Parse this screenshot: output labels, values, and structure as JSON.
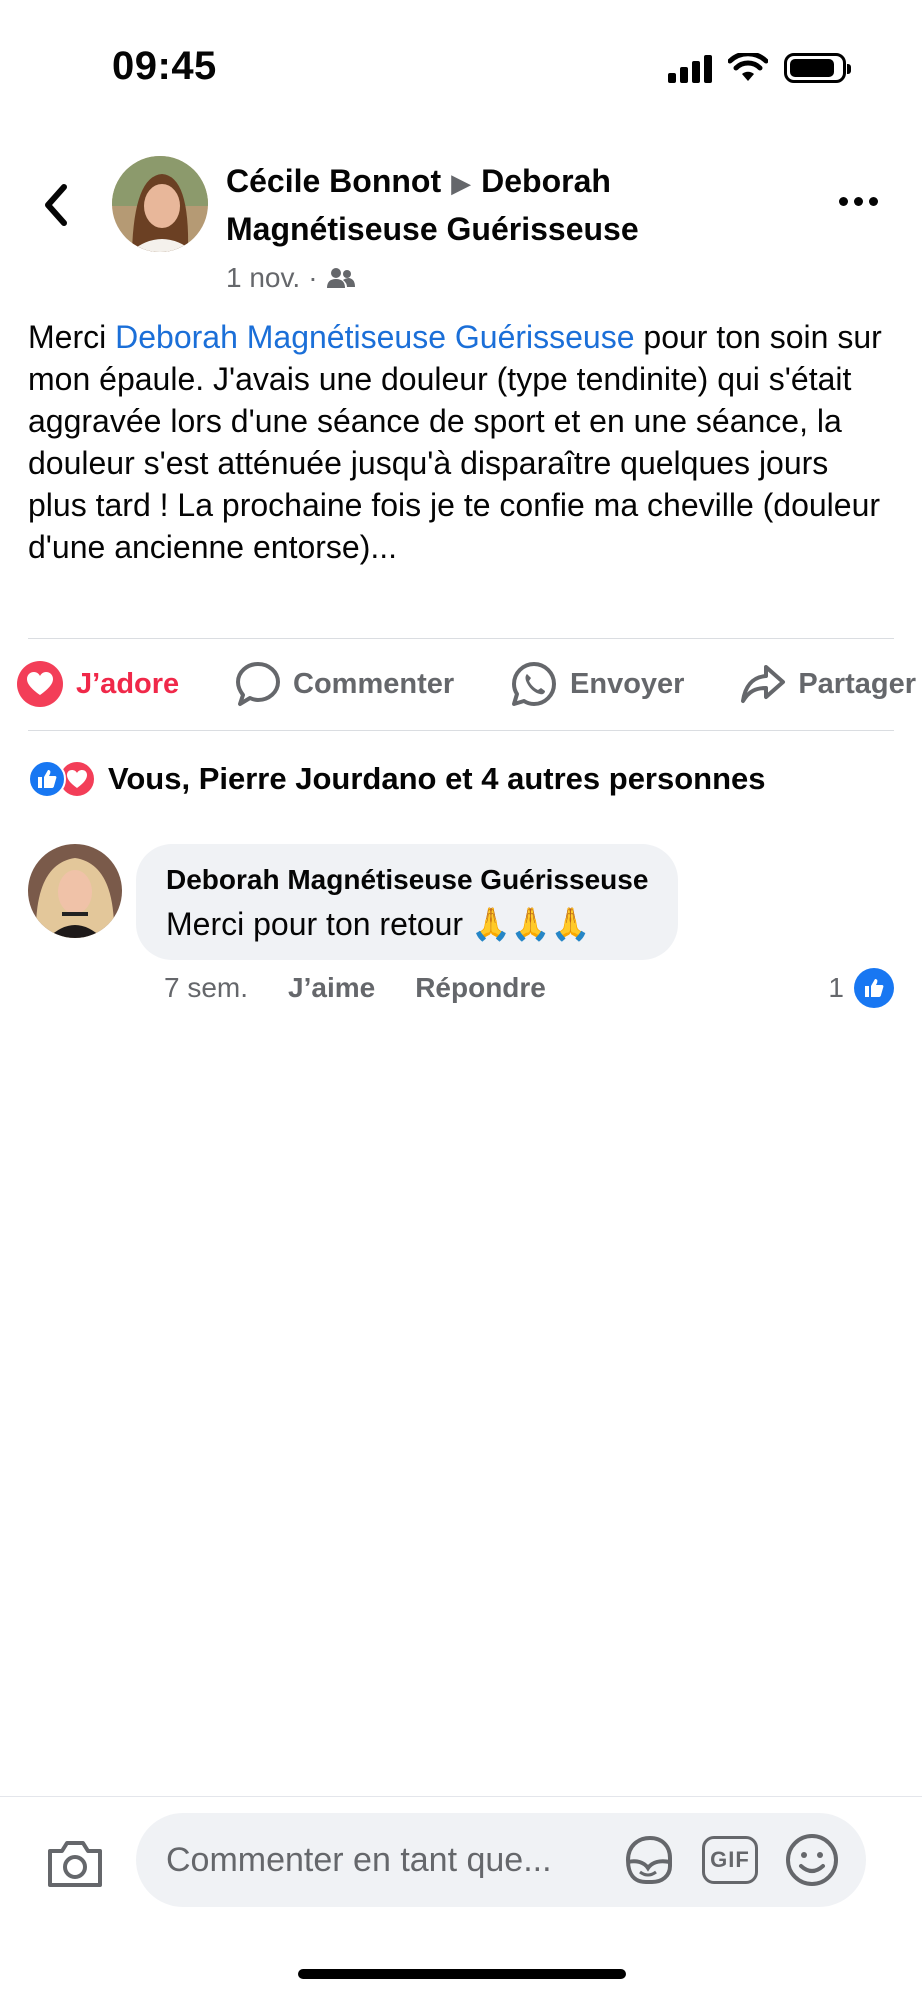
{
  "status_bar": {
    "time": "09:45"
  },
  "header": {
    "author": "Cécile Bonnot",
    "separator": "▶",
    "target": "Deborah Magnétiseuse Guérisseuse",
    "date": "1 nov.",
    "dot": "·"
  },
  "post": {
    "text_before": "Merci ",
    "mention": "Deborah Magnétiseuse Guérisseuse",
    "text_after": " pour ton soin sur mon épaule. J'avais une douleur (type tendinite) qui s'était aggravée lors d'une séance de sport et en une séance, la douleur s'est atténuée jusqu'à disparaître quelques jours plus tard ! La prochaine fois je te confie ma cheville (douleur d'une ancienne entorse)..."
  },
  "actions": {
    "love_label": "J’adore",
    "comment_label": "Commenter",
    "send_label": "Envoyer",
    "share_label": "Partager"
  },
  "reactions": {
    "summary": "Vous, Pierre Jourdano et 4 autres personnes"
  },
  "comment": {
    "author": "Deborah Magnétiseuse Guérisseuse",
    "text": "Merci pour ton retour",
    "emoji": "🙏🙏🙏",
    "time": "7 sem.",
    "like_label": "J’aime",
    "reply_label": "Répondre",
    "like_count": "1"
  },
  "composer": {
    "placeholder": "Commenter en tant que...",
    "gif_label": "GIF"
  },
  "colors": {
    "mention": "#1b6fd8",
    "love": "#f02849",
    "like": "#1877f2",
    "secondary_text": "#65676b"
  }
}
